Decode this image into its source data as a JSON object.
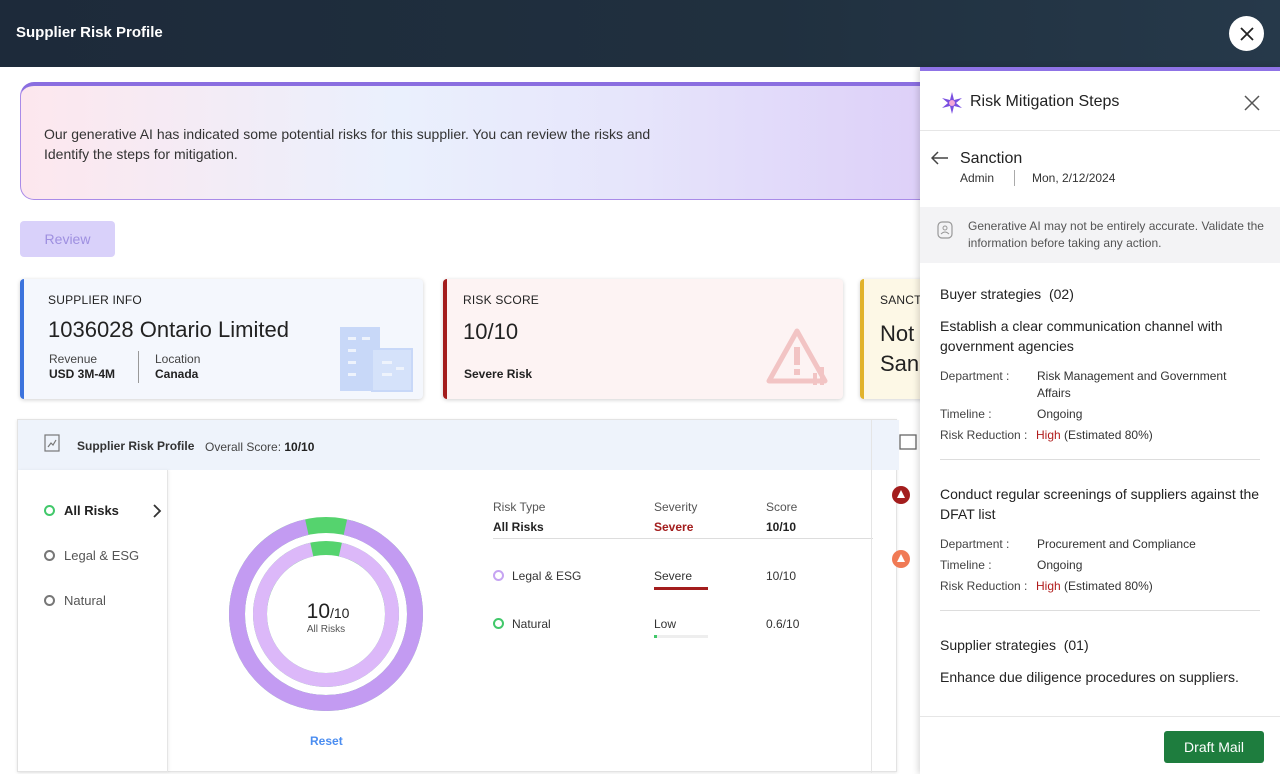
{
  "header": {
    "title": "Supplier Risk Profile"
  },
  "banner": {
    "text": "Our generative AI has indicated some potential risks for this supplier. You can review the risks and Identify the steps for mitigation."
  },
  "review_label": "Review",
  "supplier_card": {
    "label": "SUPPLIER INFO",
    "name": "1036028 Ontario Limited",
    "revenue_label": "Revenue",
    "revenue_value": "USD 3M-4M",
    "location_label": "Location",
    "location_value": "Canada"
  },
  "risk_card": {
    "label": "RISK SCORE",
    "score": "10/10",
    "severity": "Severe Risk"
  },
  "sanction_card": {
    "label": "SANCT",
    "line1": "Not",
    "line2": "San"
  },
  "profile": {
    "title": "Supplier Risk Profile",
    "overall_label": "Overall Score:",
    "overall_value": "10/10",
    "risk_filters": [
      "All Risks",
      "Legal & ESG",
      "Natural"
    ],
    "donut": {
      "score": "10",
      "denominator": "/10",
      "caption": "All Risks",
      "outer_level": 0.93,
      "inner_level": 0.93
    },
    "reset": "Reset",
    "table": {
      "headers": [
        "Risk Type",
        "Severity",
        "Score"
      ],
      "summary": {
        "type": "All Risks",
        "severity": "Severe",
        "score": "10/10"
      },
      "rows": [
        {
          "type": "Legal & ESG",
          "severity": "Severe",
          "score": "10/10",
          "level": 1.0
        },
        {
          "type": "Natural",
          "severity": "Low",
          "score": "0.6/10",
          "level": 0.06
        }
      ]
    }
  },
  "drawer": {
    "title": "Risk Mitigation Steps",
    "section": "Sanction",
    "author": "Admin",
    "date": "Mon, 2/12/2024",
    "notice": "Generative AI may not be entirely accurate. Validate the information before taking any action.",
    "buyer_heading": "Buyer strategies",
    "buyer_count": "(02)",
    "buyer": [
      {
        "title": "Establish a clear communication channel with government agencies",
        "department": "Risk Management and Government Affairs",
        "timeline": "Ongoing",
        "reduction": "High",
        "estimate": "(Estimated 80%)"
      },
      {
        "title": "Conduct regular screenings of suppliers against the DFAT list",
        "department": "Procurement and Compliance",
        "timeline": "Ongoing",
        "reduction": "High",
        "estimate": "(Estimated 80%)"
      }
    ],
    "labels": {
      "department": "Department :",
      "timeline": "Timeline :",
      "reduction": "Risk Reduction :"
    },
    "supplier_heading": "Supplier strategies",
    "supplier_count": "(01)",
    "supplier": [
      {
        "title": "Enhance due diligence procedures on suppliers."
      }
    ],
    "draft_mail": "Draft Mail"
  }
}
